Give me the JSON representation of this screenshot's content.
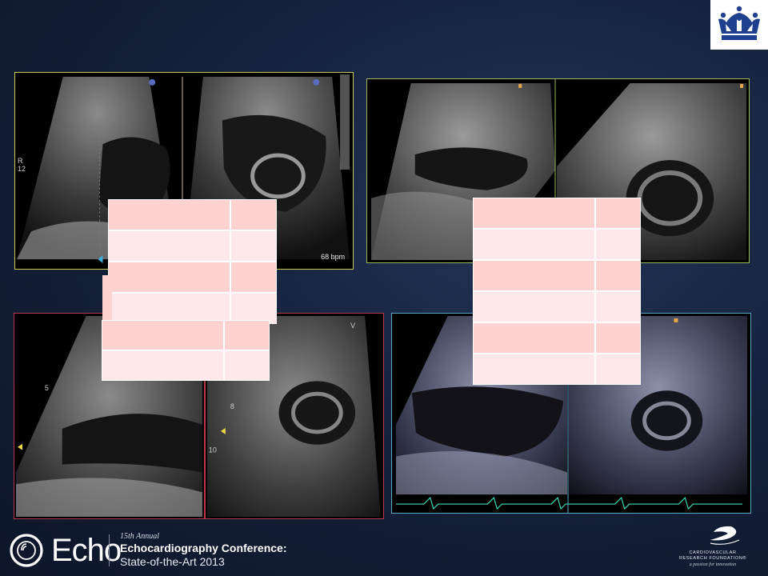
{
  "slide": {
    "background": "#16223d",
    "logo": {
      "name": "columbia-crown",
      "color": "#1a3a8a"
    }
  },
  "panels": {
    "top_left": {
      "border_color": "#c8c850",
      "labels": {
        "depth": "12",
        "heart_rate": "68 bpm",
        "marker": "R"
      }
    },
    "top_right": {
      "border_color": "#9ab85a"
    },
    "bottom_left": {
      "border_color": "#b8384a",
      "labels": {
        "depth_5": "5",
        "depth_8": "8",
        "depth_10": "10",
        "marker": "V"
      }
    },
    "bottom_right": {
      "border_color": "#5aa8c8"
    }
  },
  "overlay_tables": {
    "fill_dark": "#ffd2d2",
    "fill_light": "#ffe8ea",
    "table_a_rows": 4,
    "table_b_rows": 2,
    "table_c_rows": 6
  },
  "footer": {
    "brand_word": "Echo",
    "annual": "15th Annual",
    "conference_title": "Echocardiography Conference:",
    "conference_subtitle": "State-of-the-Art 2013",
    "sponsor_name_line1": "CARDIOVASCULAR",
    "sponsor_name_line2": "RESEARCH FOUNDATION®",
    "sponsor_tagline": "a passion for innovation"
  }
}
